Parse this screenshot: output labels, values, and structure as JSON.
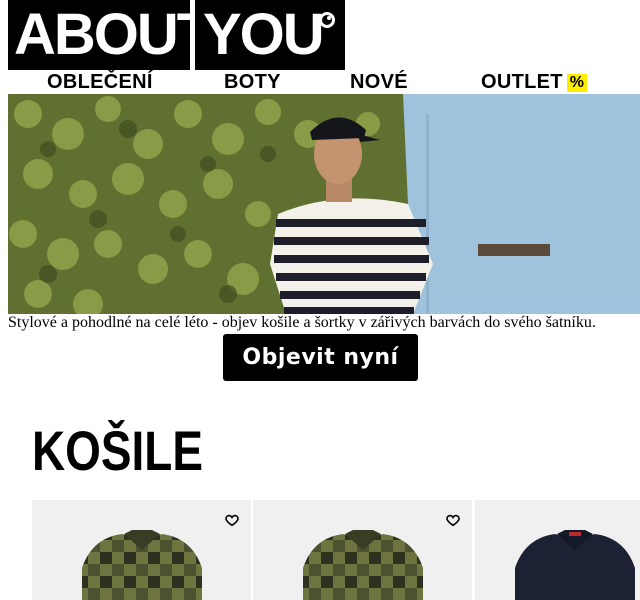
{
  "logo": {
    "part1": "ABOUT",
    "part2": "YOU"
  },
  "nav": {
    "items": [
      {
        "label": "OBLEČENÍ"
      },
      {
        "label": "BOTY"
      },
      {
        "label": "NOVÉ"
      },
      {
        "label": "OUTLET",
        "badge": "%"
      }
    ]
  },
  "hero": {
    "caption": "Stylové a pohodlné na celé léto - objev košile a šortky v zářivých barvách do svého šatníku.",
    "cta_label": "Objevit nyní"
  },
  "section": {
    "title": "KOŠILE"
  },
  "products": [
    {
      "image": "green-checked-shirt",
      "wishlist_icon": "heart-outline-icon"
    },
    {
      "image": "green-checked-shirt",
      "wishlist_icon": "heart-outline-icon"
    },
    {
      "image": "navy-shirt"
    }
  ],
  "colors": {
    "badge_yellow": "#ffed00",
    "black": "#000000"
  }
}
